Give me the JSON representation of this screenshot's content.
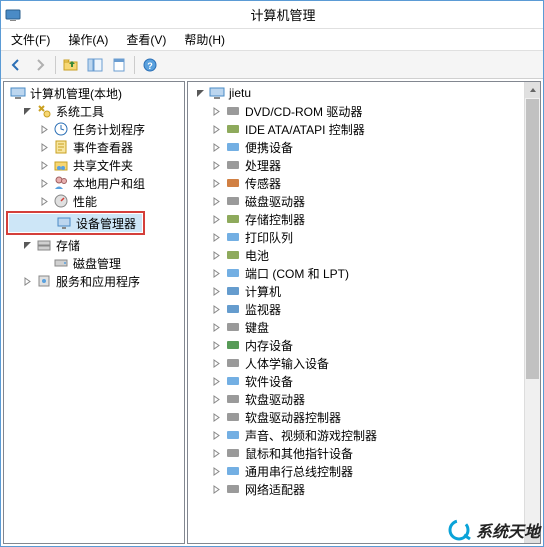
{
  "title": "计算机管理",
  "menu": {
    "file": "文件(F)",
    "action": "操作(A)",
    "view": "查看(V)",
    "help": "帮助(H)"
  },
  "toolbar": {
    "back": "back-icon",
    "forward": "forward-icon",
    "up": "up-icon",
    "show": "show-hide-icon",
    "refresh": "refresh-icon",
    "help": "help-icon"
  },
  "left_tree": {
    "root": "计算机管理(本地)",
    "groups": [
      {
        "label": "系统工具",
        "children": [
          {
            "label": "任务计划程序"
          },
          {
            "label": "事件查看器"
          },
          {
            "label": "共享文件夹"
          },
          {
            "label": "本地用户和组"
          },
          {
            "label": "性能"
          },
          {
            "label": "设备管理器"
          }
        ]
      },
      {
        "label": "存储",
        "children": [
          {
            "label": "磁盘管理"
          }
        ]
      },
      {
        "label": "服务和应用程序",
        "children": []
      }
    ]
  },
  "right_tree": {
    "root": "jietu",
    "items": [
      "DVD/CD-ROM 驱动器",
      "IDE ATA/ATAPI 控制器",
      "便携设备",
      "处理器",
      "传感器",
      "磁盘驱动器",
      "存储控制器",
      "打印队列",
      "电池",
      "端口 (COM 和 LPT)",
      "计算机",
      "监视器",
      "键盘",
      "内存设备",
      "人体学输入设备",
      "软件设备",
      "软盘驱动器",
      "软盘驱动器控制器",
      "声音、视频和游戏控制器",
      "鼠标和其他指针设备",
      "通用串行总线控制器",
      "网络适配器"
    ]
  },
  "watermark": "系统天地"
}
